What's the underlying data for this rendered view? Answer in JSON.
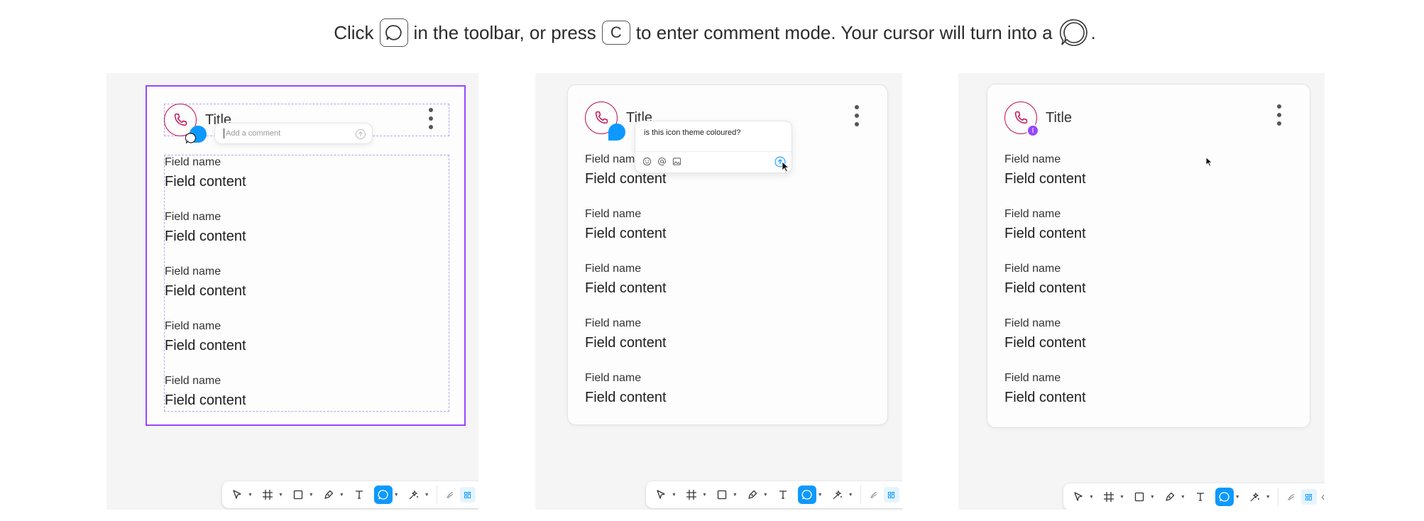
{
  "instruction": {
    "part1": "Click",
    "part2": "in the toolbar, or press",
    "key": "C",
    "part3": "to enter comment mode. Your cursor will turn into a",
    "part4": "."
  },
  "card": {
    "title": "Title",
    "fields": [
      {
        "name": "Field name",
        "content": "Field content"
      },
      {
        "name": "Field name",
        "content": "Field content"
      },
      {
        "name": "Field name",
        "content": "Field content"
      },
      {
        "name": "Field name",
        "content": "Field content"
      },
      {
        "name": "Field name",
        "content": "Field content"
      }
    ]
  },
  "panel1": {
    "comment_placeholder": "Add a comment"
  },
  "panel2": {
    "comment_text": "is this icon theme coloured?"
  },
  "panel3": {
    "avatar_initial": "I"
  },
  "colors": {
    "accent_blue": "#0d99ff",
    "selection_purple": "#9747ff",
    "icon_pink": "#c2185b",
    "panel_bg": "#f5f5f5"
  },
  "toolbar": {
    "tools": [
      "move-icon",
      "frame-icon",
      "shape-icon",
      "pen-icon",
      "text-icon",
      "comment-icon",
      "actions-icon"
    ],
    "active_tool": "comment-icon",
    "modes": [
      "draw-mode-icon",
      "design-mode-icon",
      "dev-mode-icon"
    ]
  }
}
